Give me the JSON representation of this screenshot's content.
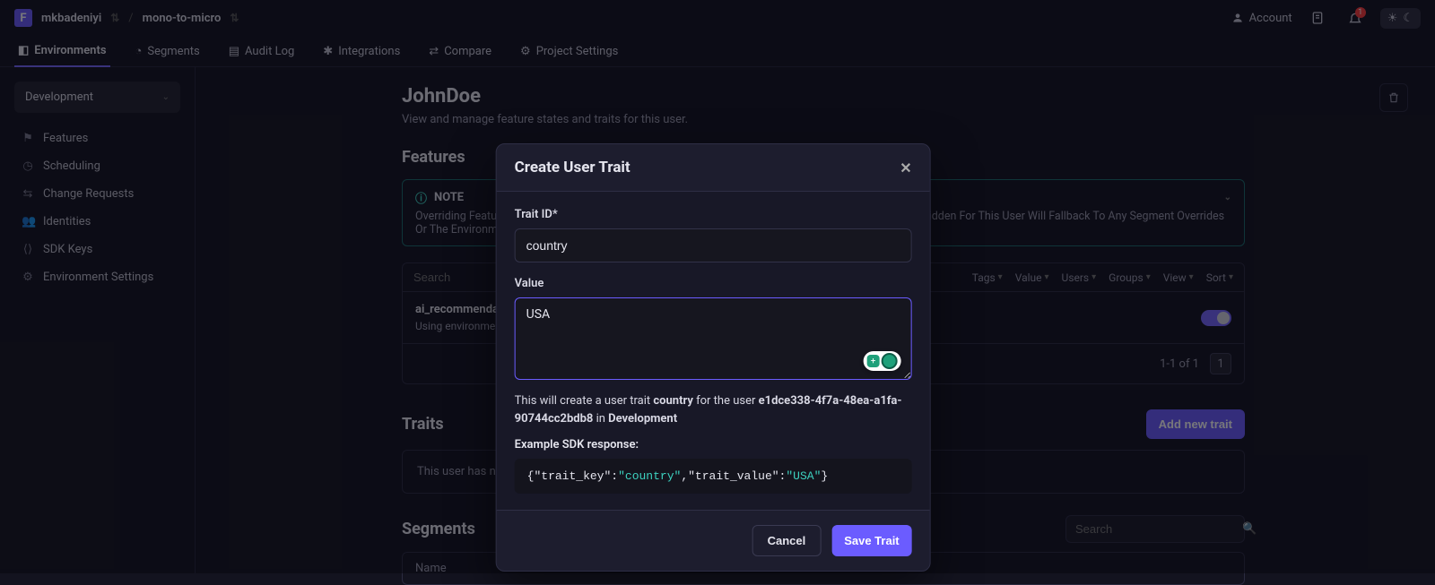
{
  "breadcrumb": {
    "org": "mkbadeniyi",
    "project": "mono-to-micro"
  },
  "topbar": {
    "account": "Account",
    "badge": "1"
  },
  "nav": {
    "environments": "Environments",
    "segments": "Segments",
    "audit": "Audit Log",
    "integrations": "Integrations",
    "compare": "Compare",
    "settings": "Project Settings"
  },
  "sidebar": {
    "env": "Development",
    "items": {
      "features": "Features",
      "scheduling": "Scheduling",
      "change_requests": "Change Requests",
      "identities": "Identities",
      "sdk_keys": "SDK Keys",
      "env_settings": "Environment Settings"
    }
  },
  "page": {
    "title": "JohnDoe",
    "subtitle": "View and manage feature states and traits for this user."
  },
  "features": {
    "heading": "Features",
    "note_label": "NOTE",
    "note_text": "Overriding Features Here Will Take Priority Over Any Segment Override. Any Features That Are Not Overridden For This User Will Fallback To Any Segment Overrides Or The Environment Defaults.",
    "search_placeholder": "Search",
    "filters": {
      "tags": "Tags",
      "value": "Value",
      "users": "Users",
      "groups": "Groups",
      "view": "View",
      "sort": "Sort"
    },
    "row_name": "ai_recommendation_engine",
    "row_sub": "Using environment defaults",
    "pagination": "1-1 of 1",
    "page_num": "1"
  },
  "traits": {
    "heading": "Traits",
    "add_button": "Add new trait",
    "empty": "This user has no traits."
  },
  "segments": {
    "heading": "Segments",
    "search_placeholder": "Search",
    "name_col": "Name"
  },
  "modal": {
    "title": "Create User Trait",
    "trait_id_label": "Trait ID*",
    "trait_id_value": "country",
    "value_label": "Value",
    "value_text": "USA",
    "hint_pre": "This will create a user trait ",
    "hint_trait": "country",
    "hint_mid": " for the user ",
    "hint_user": "e1dce338-4f7a-48ea-a1fa-90744cc2bdb8",
    "hint_in": " in ",
    "hint_env": "Development",
    "example_label": "Example SDK response:",
    "code_key": "\"trait_key\"",
    "code_keyval": "\"country\"",
    "code_val": "\"trait_value\"",
    "code_valval": "\"USA\"",
    "cancel": "Cancel",
    "save": "Save Trait"
  }
}
